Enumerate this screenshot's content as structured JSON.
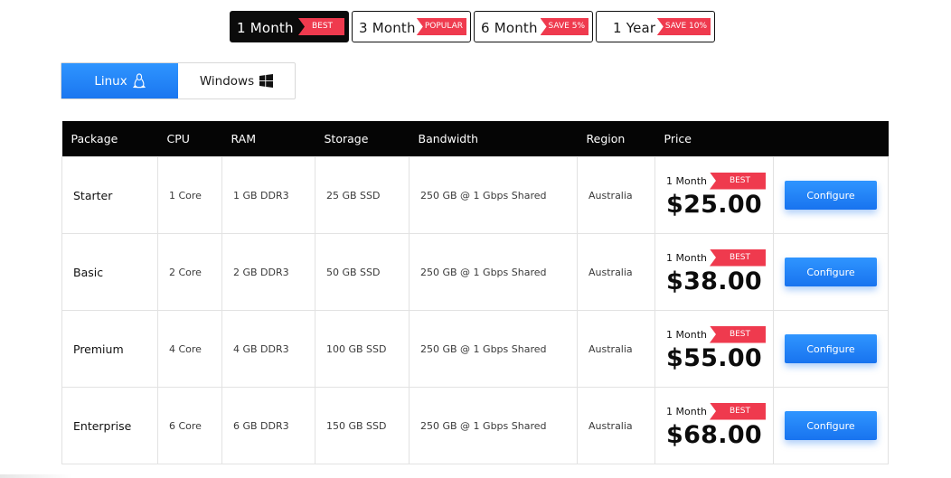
{
  "billing_periods": [
    {
      "label": "1 Month",
      "tag": "BEST",
      "active": true
    },
    {
      "label": "3 Month",
      "tag": "POPULAR",
      "active": false
    },
    {
      "label": "6 Month",
      "tag": "SAVE 5%",
      "active": false
    },
    {
      "label": "1 Year",
      "tag": "SAVE 10%",
      "active": false
    }
  ],
  "os_tabs": [
    {
      "label": "Linux",
      "icon": "linux-penguin-icon",
      "active": true
    },
    {
      "label": "Windows",
      "icon": "windows-logo-icon",
      "active": false
    }
  ],
  "table": {
    "headers": [
      "Package",
      "CPU",
      "RAM",
      "Storage",
      "Bandwidth",
      "Region",
      "Price",
      ""
    ],
    "rows": [
      {
        "package": "Starter",
        "cpu": "1 Core",
        "ram": "1 GB DDR3",
        "storage": "25 GB SSD",
        "bandwidth": "250 GB @ 1 Gbps Shared",
        "region": "Australia",
        "price_period": "1 Month",
        "price_tag": "BEST",
        "price": "$25.00",
        "action": "Configure"
      },
      {
        "package": "Basic",
        "cpu": "2 Core",
        "ram": "2 GB DDR3",
        "storage": "50 GB SSD",
        "bandwidth": "250 GB @ 1 Gbps Shared",
        "region": "Australia",
        "price_period": "1 Month",
        "price_tag": "BEST",
        "price": "$38.00",
        "action": "Configure"
      },
      {
        "package": "Premium",
        "cpu": "4 Core",
        "ram": "4 GB DDR3",
        "storage": "100 GB SSD",
        "bandwidth": "250 GB @ 1 Gbps Shared",
        "region": "Australia",
        "price_period": "1 Month",
        "price_tag": "BEST",
        "price": "$55.00",
        "action": "Configure"
      },
      {
        "package": "Enterprise",
        "cpu": "6 Core",
        "ram": "6 GB DDR3",
        "storage": "150 GB SSD",
        "bandwidth": "250 GB @ 1 Gbps Shared",
        "region": "Australia",
        "price_period": "1 Month",
        "price_tag": "BEST",
        "price": "$68.00",
        "action": "Configure"
      }
    ]
  },
  "colors": {
    "accent": "#1a76f0",
    "tag": "#ef3a4e",
    "header_bg": "#050505"
  }
}
